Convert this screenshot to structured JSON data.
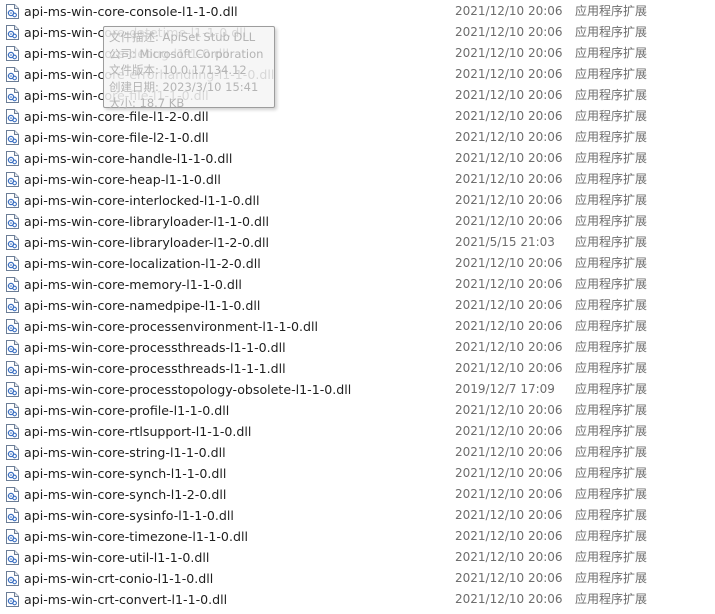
{
  "files": [
    {
      "name": "api-ms-win-core-console-l1-1-0.dll",
      "date": "2021/12/10 20:06",
      "type": "应用程序扩展",
      "icon": "dll-file-icon"
    },
    {
      "name": "api-ms-win-core-datetime-l1-1-0.dll",
      "date": "2021/12/10 20:06",
      "type": "应用程序扩展",
      "icon": "dll-file-icon"
    },
    {
      "name": "api-ms-win-core-debug-l1-1-0.dll",
      "date": "2021/12/10 20:06",
      "type": "应用程序扩展",
      "icon": "dll-file-icon"
    },
    {
      "name": "api-ms-win-core-errorhandling-l1-1-0.dll",
      "date": "2021/12/10 20:06",
      "type": "应用程序扩展",
      "icon": "dll-file-icon"
    },
    {
      "name": "api-ms-win-core-file-l1-1-0.dll",
      "date": "2021/12/10 20:06",
      "type": "应用程序扩展",
      "icon": "dll-file-icon"
    },
    {
      "name": "api-ms-win-core-file-l1-2-0.dll",
      "date": "2021/12/10 20:06",
      "type": "应用程序扩展",
      "icon": "dll-file-icon"
    },
    {
      "name": "api-ms-win-core-file-l2-1-0.dll",
      "date": "2021/12/10 20:06",
      "type": "应用程序扩展",
      "icon": "dll-file-icon"
    },
    {
      "name": "api-ms-win-core-handle-l1-1-0.dll",
      "date": "2021/12/10 20:06",
      "type": "应用程序扩展",
      "icon": "dll-file-icon"
    },
    {
      "name": "api-ms-win-core-heap-l1-1-0.dll",
      "date": "2021/12/10 20:06",
      "type": "应用程序扩展",
      "icon": "dll-file-icon"
    },
    {
      "name": "api-ms-win-core-interlocked-l1-1-0.dll",
      "date": "2021/12/10 20:06",
      "type": "应用程序扩展",
      "icon": "dll-file-icon"
    },
    {
      "name": "api-ms-win-core-libraryloader-l1-1-0.dll",
      "date": "2021/12/10 20:06",
      "type": "应用程序扩展",
      "icon": "dll-file-icon"
    },
    {
      "name": "api-ms-win-core-libraryloader-l1-2-0.dll",
      "date": "2021/5/15 21:03",
      "type": "应用程序扩展",
      "icon": "dll-file-icon"
    },
    {
      "name": "api-ms-win-core-localization-l1-2-0.dll",
      "date": "2021/12/10 20:06",
      "type": "应用程序扩展",
      "icon": "dll-file-icon"
    },
    {
      "name": "api-ms-win-core-memory-l1-1-0.dll",
      "date": "2021/12/10 20:06",
      "type": "应用程序扩展",
      "icon": "dll-file-icon"
    },
    {
      "name": "api-ms-win-core-namedpipe-l1-1-0.dll",
      "date": "2021/12/10 20:06",
      "type": "应用程序扩展",
      "icon": "dll-file-icon"
    },
    {
      "name": "api-ms-win-core-processenvironment-l1-1-0.dll",
      "date": "2021/12/10 20:06",
      "type": "应用程序扩展",
      "icon": "dll-file-icon"
    },
    {
      "name": "api-ms-win-core-processthreads-l1-1-0.dll",
      "date": "2021/12/10 20:06",
      "type": "应用程序扩展",
      "icon": "dll-file-icon"
    },
    {
      "name": "api-ms-win-core-processthreads-l1-1-1.dll",
      "date": "2021/12/10 20:06",
      "type": "应用程序扩展",
      "icon": "dll-file-icon"
    },
    {
      "name": "api-ms-win-core-processtopology-obsolete-l1-1-0.dll",
      "date": "2019/12/7 17:09",
      "type": "应用程序扩展",
      "icon": "dll-file-icon"
    },
    {
      "name": "api-ms-win-core-profile-l1-1-0.dll",
      "date": "2021/12/10 20:06",
      "type": "应用程序扩展",
      "icon": "dll-file-icon"
    },
    {
      "name": "api-ms-win-core-rtlsupport-l1-1-0.dll",
      "date": "2021/12/10 20:06",
      "type": "应用程序扩展",
      "icon": "dll-file-icon"
    },
    {
      "name": "api-ms-win-core-string-l1-1-0.dll",
      "date": "2021/12/10 20:06",
      "type": "应用程序扩展",
      "icon": "dll-file-icon"
    },
    {
      "name": "api-ms-win-core-synch-l1-1-0.dll",
      "date": "2021/12/10 20:06",
      "type": "应用程序扩展",
      "icon": "dll-file-icon"
    },
    {
      "name": "api-ms-win-core-synch-l1-2-0.dll",
      "date": "2021/12/10 20:06",
      "type": "应用程序扩展",
      "icon": "dll-file-icon"
    },
    {
      "name": "api-ms-win-core-sysinfo-l1-1-0.dll",
      "date": "2021/12/10 20:06",
      "type": "应用程序扩展",
      "icon": "dll-file-icon"
    },
    {
      "name": "api-ms-win-core-timezone-l1-1-0.dll",
      "date": "2021/12/10 20:06",
      "type": "应用程序扩展",
      "icon": "dll-file-icon"
    },
    {
      "name": "api-ms-win-core-util-l1-1-0.dll",
      "date": "2021/12/10 20:06",
      "type": "应用程序扩展",
      "icon": "dll-file-icon"
    },
    {
      "name": "api-ms-win-crt-conio-l1-1-0.dll",
      "date": "2021/12/10 20:06",
      "type": "应用程序扩展",
      "icon": "dll-file-icon"
    },
    {
      "name": "api-ms-win-crt-convert-l1-1-0.dll",
      "date": "2021/12/10 20:06",
      "type": "应用程序扩展",
      "icon": "dll-file-icon"
    }
  ],
  "tooltip": {
    "lines": [
      "文件描述: ApiSet Stub DLL",
      "公司: Microsoft Corporation",
      "文件版本: 10.0.17134.12",
      "创建日期: 2023/3/10 15:41",
      "大小: 18.7 KB"
    ]
  },
  "colors": {
    "background": "#ffffff",
    "name_text": "#1e1e1e",
    "meta_text": "#6d6d6d",
    "icon_blue": "#3a6fc2"
  }
}
